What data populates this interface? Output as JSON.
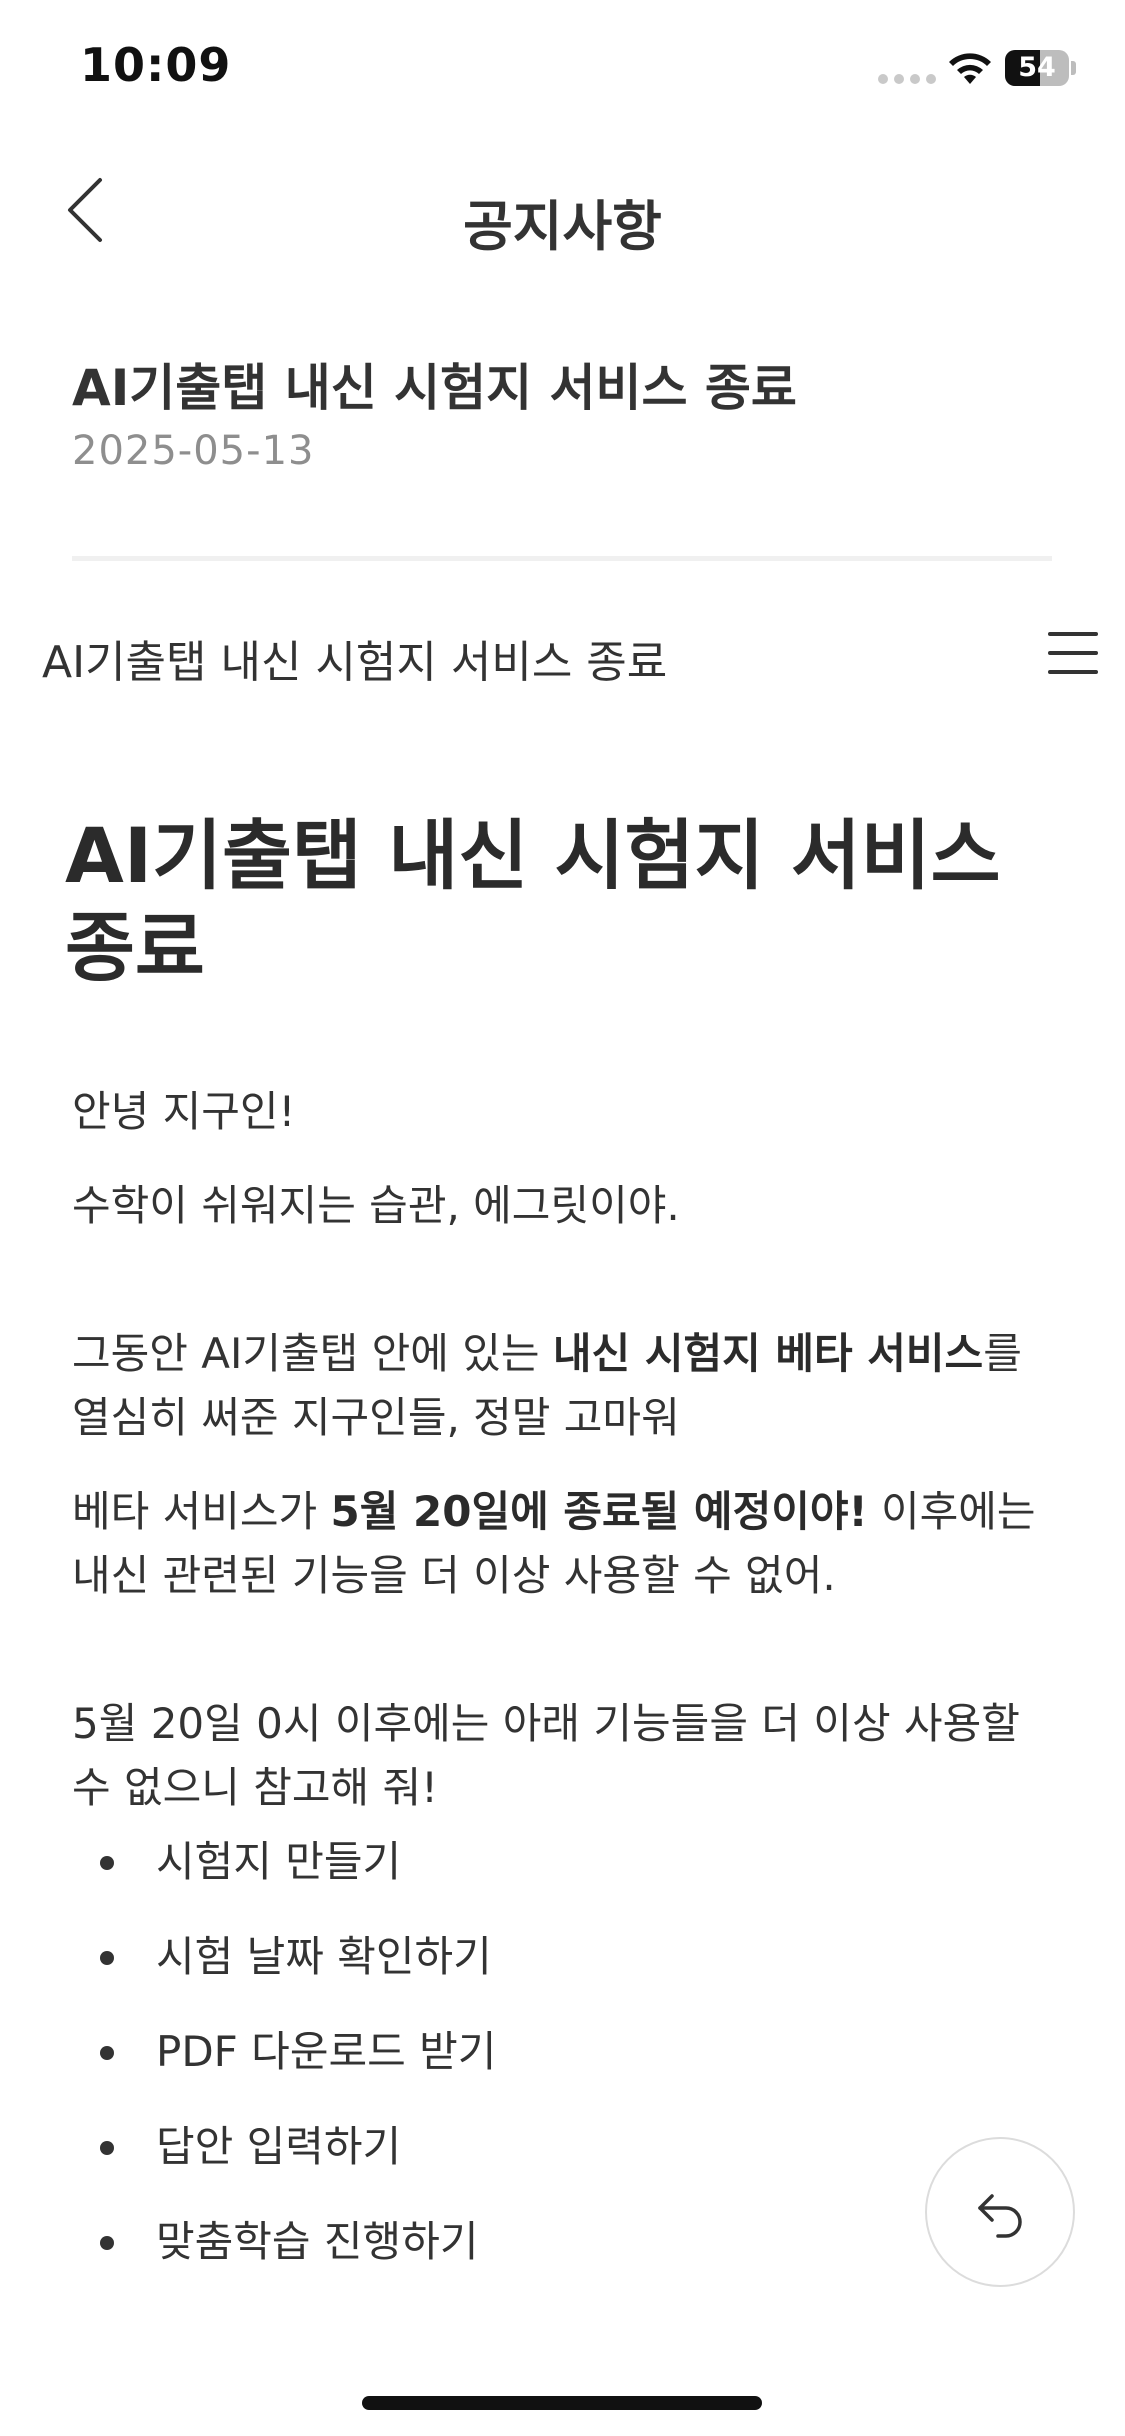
{
  "status_bar": {
    "time": "10:09",
    "battery": "54",
    "battery_level_percent": 54
  },
  "nav": {
    "title": "공지사항"
  },
  "notice": {
    "title": "AI기출탭 내신 시험지 서비스 종료",
    "date": "2025-05-13"
  },
  "doc_toolbar": {
    "title": "AI기출탭 내신 시험지 서비스 종료"
  },
  "document": {
    "heading": "AI기출탭 내신 시험지 서비스 종료",
    "greeting_1": "안녕 지구인!",
    "greeting_2": "수학이 쉬워지는 습관, 에그릿이야.",
    "para_1_before": "그동안 AI기출탭 안에 있는 ",
    "para_1_bold": "내신 시험지 베타 서비스",
    "para_1_after": "를 열심히 써준 지구인들, 정말 고마워",
    "para_2_before": "베타 서비스가 ",
    "para_2_bold": "5월 20일에 종료될 예정이야!",
    "para_2_after": " 이후에는 내신 관련된 기능을 더 이상 사용할 수 없어.",
    "para_3": "5월 20일 0시 이후에는 아래 기능들을 더 이상 사용할 수 없으니 참고해 줘!",
    "features": [
      "시험지 만들기",
      "시험 날짜 확인하기",
      "PDF 다운로드 받기",
      "답안 입력하기",
      "맞춤학습 진행하기"
    ]
  },
  "icons": {
    "back": "chevron-left-icon",
    "menu": "hamburger-menu-icon",
    "float_back": "undo-arrow-icon",
    "wifi": "wifi-icon"
  },
  "colors": {
    "text": "#333333",
    "muted": "#8e8e8e",
    "divider": "#f0f0f0"
  }
}
